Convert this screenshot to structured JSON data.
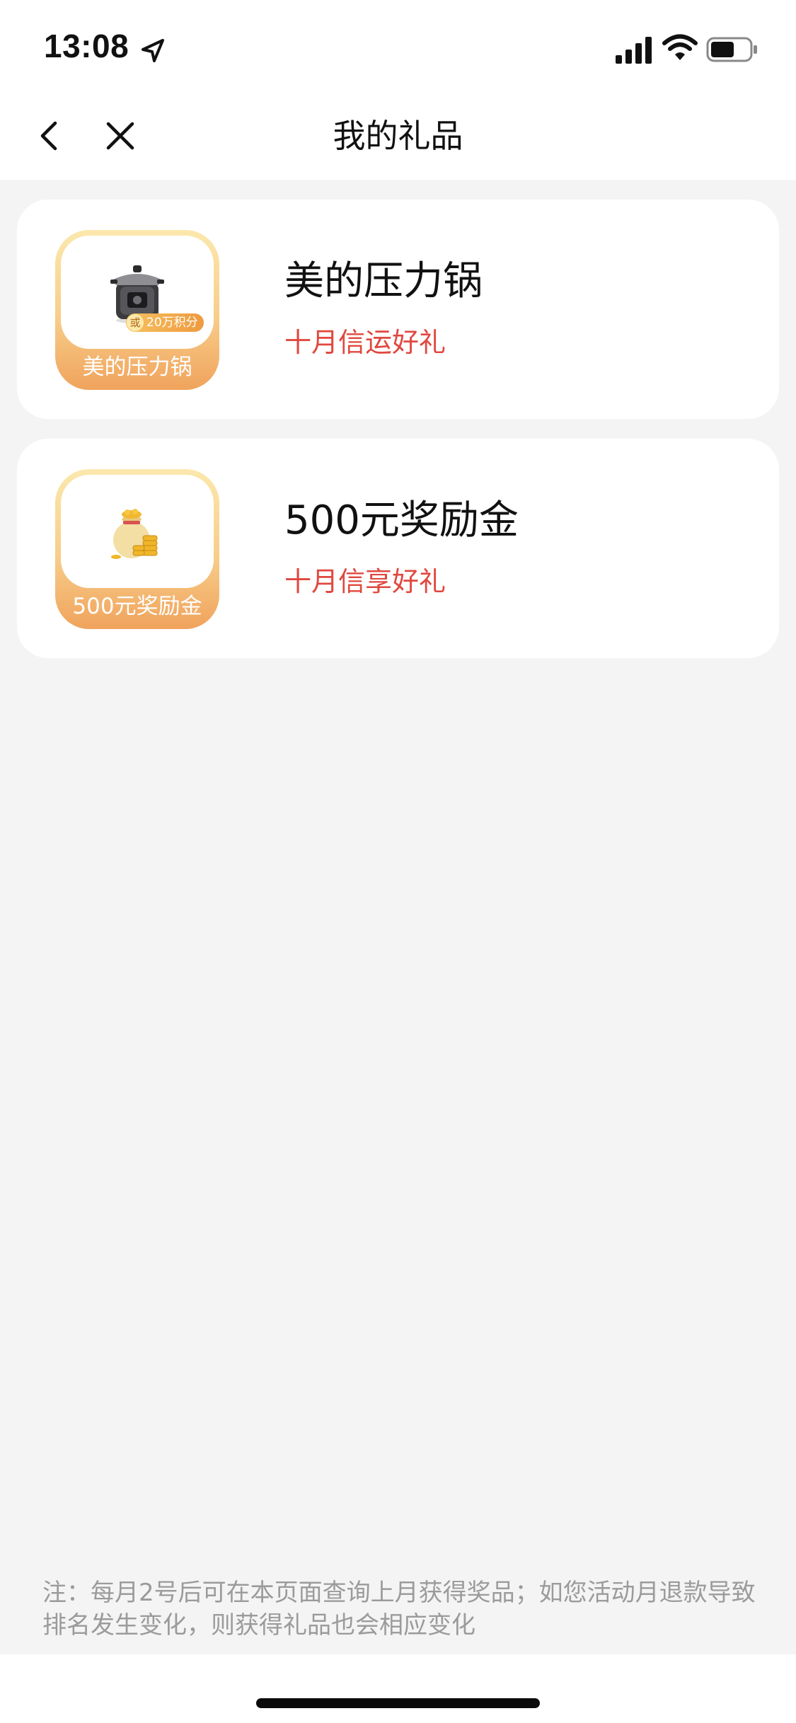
{
  "status_bar": {
    "time": "13:08",
    "icons": [
      "location-arrow-icon",
      "cellular-signal-icon",
      "wifi-icon",
      "battery-icon"
    ]
  },
  "nav": {
    "title": "我的礼品",
    "back_icon": "chevron-left-icon",
    "close_icon": "close-icon"
  },
  "gifts": [
    {
      "name": "美的压力锅",
      "subtitle": "十月信运好礼",
      "thumb_label": "美的压力锅",
      "badge_or": "或",
      "badge_points": "20万积分",
      "icon": "pressure-cooker-icon"
    },
    {
      "name": "500元奖励金",
      "subtitle": "十月信享好礼",
      "thumb_label": "500元奖励金",
      "icon": "money-bag-coins-icon"
    }
  ],
  "note": "注：每月2号后可在本页面查询上月获得奖品；如您活动月退款导致排名发生变化，则获得礼品也会相应变化",
  "colors": {
    "accent_red": "#e0483f",
    "thumb_gradient_top": "#fbe8ad",
    "thumb_gradient_bottom": "#f0a35c",
    "background": "#f4f4f4"
  }
}
